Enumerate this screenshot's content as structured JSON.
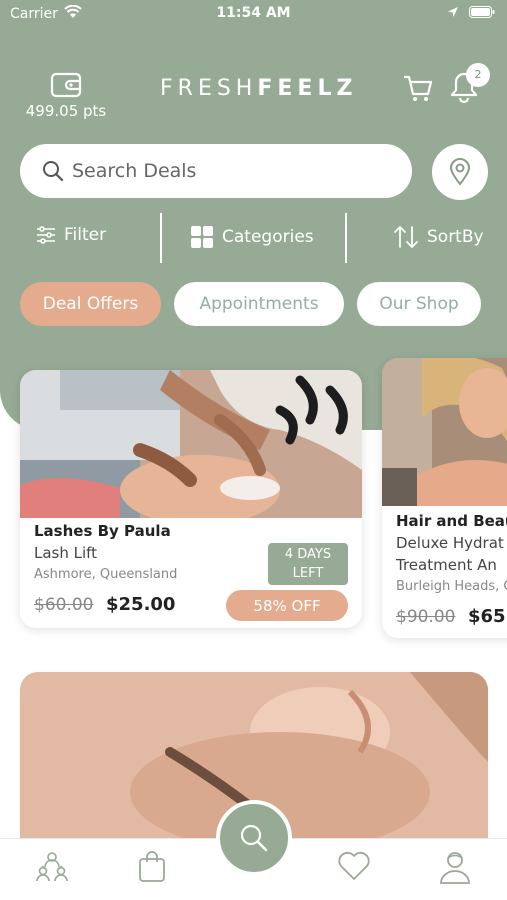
{
  "status_bar": {
    "carrier": "Carrier",
    "time": "11:54 AM"
  },
  "header": {
    "points": "499.05 pts",
    "brand_light": "FRESH",
    "brand_bold": "FEELZ",
    "notification_count": "2"
  },
  "search": {
    "placeholder": "Search Deals"
  },
  "toolbar": {
    "filter_label": "Filter",
    "categories_label": "Categories",
    "sort_label": "SortBy"
  },
  "segments": [
    {
      "label": "Deal Offers",
      "active": true
    },
    {
      "label": "Appointments",
      "active": false
    },
    {
      "label": "Our Shop",
      "active": false
    }
  ],
  "deals": [
    {
      "provider": "Lashes By Paula",
      "service": "Lash Lift",
      "location": "Ashmore, Queensland",
      "old_price": "$60.00",
      "new_price": "$25.00",
      "days_left_line1": "4 DAYS",
      "days_left_line2": "LEFT",
      "discount": "58% OFF"
    },
    {
      "provider": "Hair and Beau",
      "service_line1": "Deluxe Hydrat",
      "service_line2": "Treatment An",
      "location": "Burleigh Heads, Q",
      "old_price": "$90.00",
      "new_price": "$65."
    }
  ],
  "colors": {
    "brand_green": "#97aa96",
    "accent_peach": "#e4ab8f"
  },
  "tabbar": {
    "items": [
      "community-icon",
      "shopping-bag-icon",
      "search-icon",
      "heart-icon",
      "profile-icon"
    ]
  }
}
